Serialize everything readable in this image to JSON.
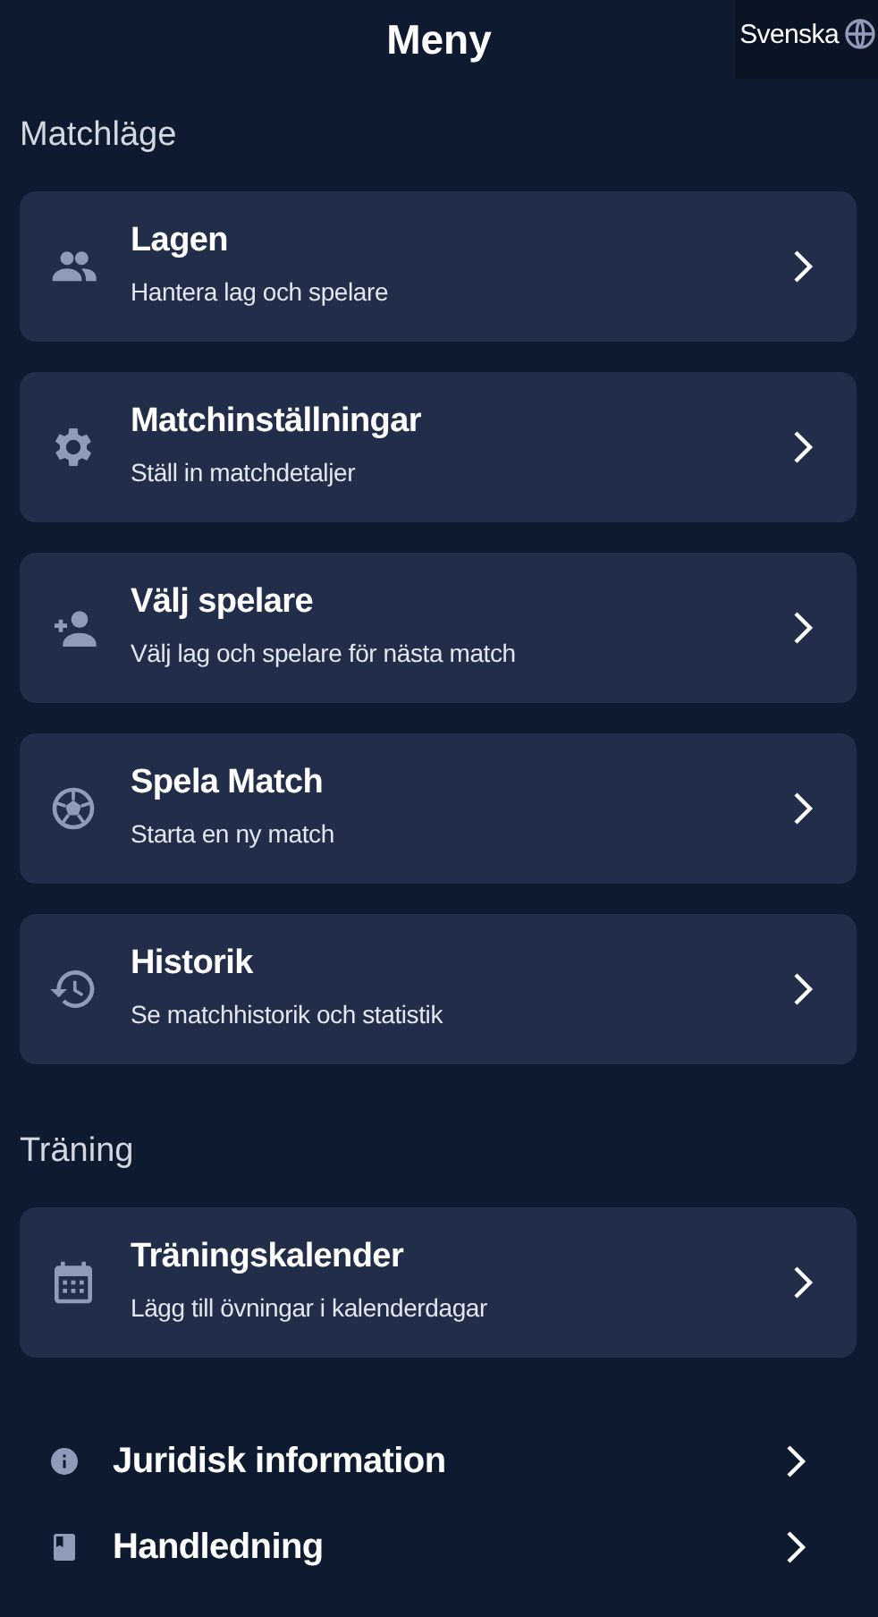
{
  "header": {
    "title": "Meny",
    "language": "Svenska"
  },
  "sections": [
    {
      "heading": "Matchläge",
      "items": [
        {
          "title": "Lagen",
          "subtitle": "Hantera lag och spelare"
        },
        {
          "title": "Matchinställningar",
          "subtitle": "Ställ in matchdetaljer"
        },
        {
          "title": "Välj spelare",
          "subtitle": "Välj lag och spelare för nästa match"
        },
        {
          "title": "Spela Match",
          "subtitle": "Starta en ny match"
        },
        {
          "title": "Historik",
          "subtitle": "Se matchhistorik och statistik"
        }
      ]
    },
    {
      "heading": "Träning",
      "items": [
        {
          "title": "Träningskalender",
          "subtitle": "Lägg till övningar i kalenderdagar"
        }
      ]
    }
  ],
  "links": [
    {
      "label": "Juridisk information"
    },
    {
      "label": "Handledning"
    }
  ]
}
